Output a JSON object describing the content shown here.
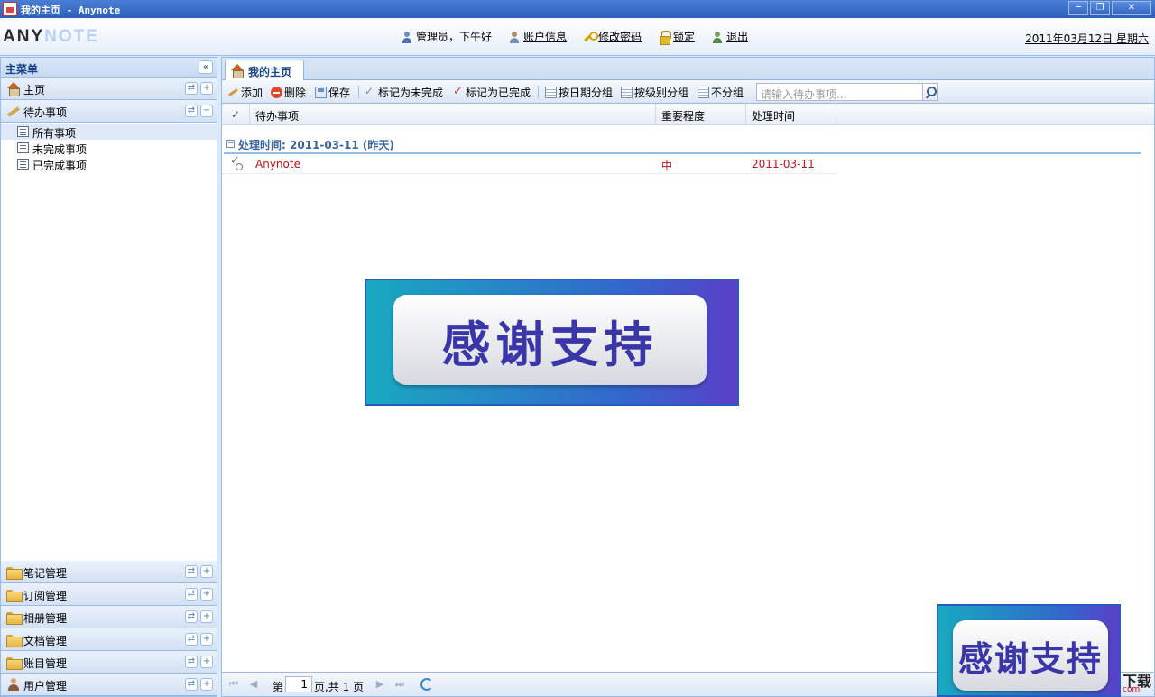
{
  "window": {
    "title": "我的主页 - Anynote",
    "minimize": "─",
    "restore": "❐",
    "close": "✕"
  },
  "header": {
    "logo_a": "ANY",
    "logo_b": "NOTE",
    "user_greeting": "管理员，下午好",
    "account_info": "账户信息",
    "change_password": "修改密码",
    "lock": "锁定",
    "logout": "退出",
    "date": "2011年03月12日 星期六"
  },
  "sidebar": {
    "title": "主菜单",
    "collapse": "«",
    "top_sections": [
      {
        "label": "主页",
        "icon": "home-icon"
      },
      {
        "label": "待办事项",
        "icon": "pen-icon"
      }
    ],
    "todo_items": [
      "所有事项",
      "未完成事项",
      "已完成事项"
    ],
    "bottom_sections": [
      {
        "label": "笔记管理",
        "icon": "folder-icon"
      },
      {
        "label": "订阅管理",
        "icon": "folder-icon"
      },
      {
        "label": "相册管理",
        "icon": "folder-icon"
      },
      {
        "label": "文档管理",
        "icon": "folder-icon"
      },
      {
        "label": "账目管理",
        "icon": "folder-icon"
      },
      {
        "label": "用户管理",
        "icon": "user-icon"
      }
    ],
    "tool_refresh": "⇄",
    "tool_expand": "+",
    "tool_collapse": "−"
  },
  "main": {
    "tab_label": "我的主页",
    "toolbar": {
      "add": "添加",
      "delete": "删除",
      "save": "保存",
      "mark_incomplete": "标记为未完成",
      "mark_complete": "标记为已完成",
      "group_by_date": "按日期分组",
      "group_by_level": "按级别分组",
      "no_group": "不分组",
      "search_placeholder": "请输入待办事项..."
    },
    "columns": {
      "check": "✓",
      "task": "待办事项",
      "importance": "重要程度",
      "time": "处理时间"
    },
    "group_header": "处理时间: 2011-03-11 (昨天)",
    "group_toggle": "−",
    "rows": [
      {
        "task": "Anynote",
        "importance": "中",
        "time": "2011-03-11"
      }
    ],
    "pager": {
      "first": "⏮",
      "prev": "◀",
      "page_prefix": "第",
      "page_value": "1",
      "page_suffix": "页,共 1 页",
      "next": "▶",
      "last": "⏭"
    }
  },
  "banners": {
    "text": "感谢支持",
    "watermark": "下载",
    "watermark_small": "com"
  },
  "colors": {
    "accent": "#15428b",
    "border": "#99bbe8",
    "row_text": "#c0141c"
  }
}
